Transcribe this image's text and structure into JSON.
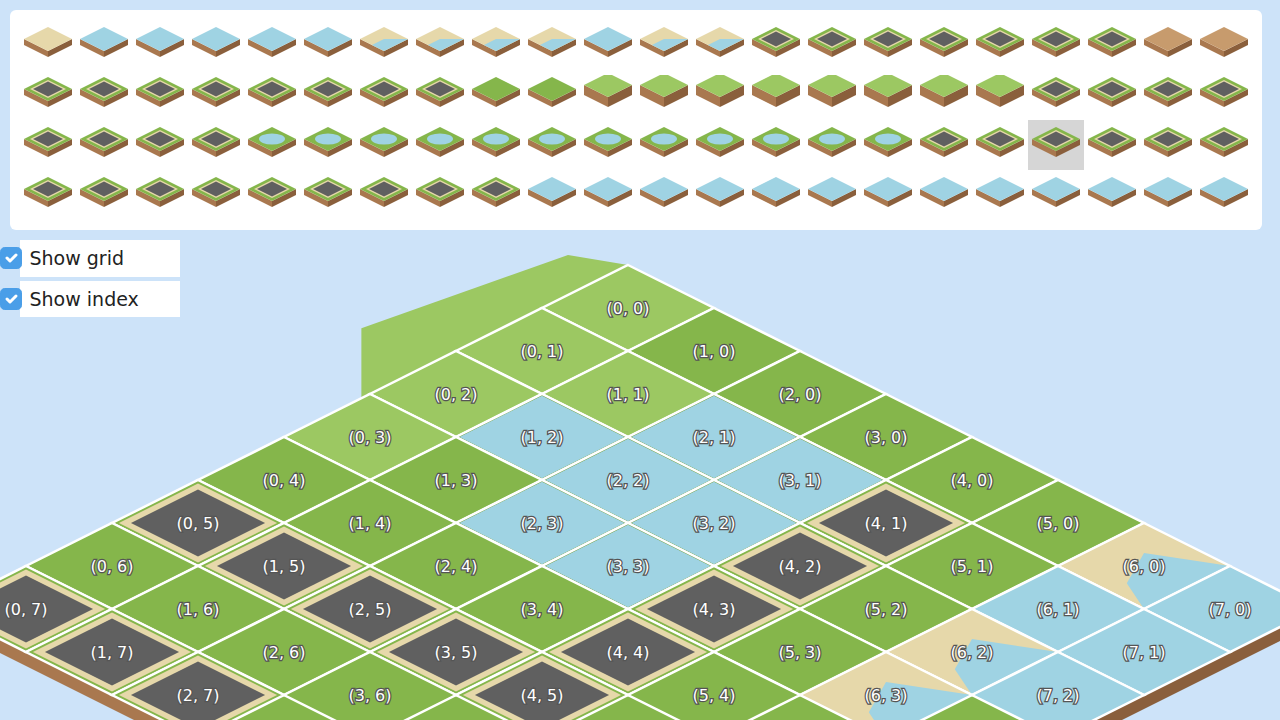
{
  "palette": {
    "tiles": [
      {
        "kind": "sand",
        "selected": false
      },
      {
        "kind": "water",
        "selected": false
      },
      {
        "kind": "water",
        "selected": false
      },
      {
        "kind": "water",
        "selected": false
      },
      {
        "kind": "water",
        "selected": false
      },
      {
        "kind": "water",
        "selected": false
      },
      {
        "kind": "shore",
        "selected": false
      },
      {
        "kind": "shore",
        "selected": false
      },
      {
        "kind": "shore",
        "selected": false
      },
      {
        "kind": "shore",
        "selected": false
      },
      {
        "kind": "water",
        "selected": false
      },
      {
        "kind": "shore",
        "selected": false
      },
      {
        "kind": "shore",
        "selected": false
      },
      {
        "kind": "road",
        "selected": false
      },
      {
        "kind": "road",
        "selected": false
      },
      {
        "kind": "road",
        "selected": false
      },
      {
        "kind": "road",
        "selected": false
      },
      {
        "kind": "road",
        "selected": false
      },
      {
        "kind": "road",
        "selected": false
      },
      {
        "kind": "road",
        "selected": false
      },
      {
        "kind": "dirt",
        "selected": false
      },
      {
        "kind": "dirt",
        "selected": false
      },
      {
        "kind": "road",
        "selected": false
      },
      {
        "kind": "road",
        "selected": false
      },
      {
        "kind": "road",
        "selected": false
      },
      {
        "kind": "road",
        "selected": false
      },
      {
        "kind": "road",
        "selected": false
      },
      {
        "kind": "road",
        "selected": false
      },
      {
        "kind": "road",
        "selected": false
      },
      {
        "kind": "road",
        "selected": false
      },
      {
        "kind": "grass",
        "selected": false
      },
      {
        "kind": "grass",
        "selected": false
      },
      {
        "kind": "hill",
        "selected": false
      },
      {
        "kind": "hill",
        "selected": false
      },
      {
        "kind": "hill",
        "selected": false
      },
      {
        "kind": "hill",
        "selected": false
      },
      {
        "kind": "hill",
        "selected": false
      },
      {
        "kind": "hill",
        "selected": false
      },
      {
        "kind": "hill",
        "selected": false
      },
      {
        "kind": "hill",
        "selected": false
      },
      {
        "kind": "road",
        "selected": false
      },
      {
        "kind": "road",
        "selected": false
      },
      {
        "kind": "road",
        "selected": false
      },
      {
        "kind": "road",
        "selected": false
      },
      {
        "kind": "road",
        "selected": false
      },
      {
        "kind": "road",
        "selected": false
      },
      {
        "kind": "road",
        "selected": false
      },
      {
        "kind": "road",
        "selected": false
      },
      {
        "kind": "pond",
        "selected": false
      },
      {
        "kind": "pond",
        "selected": false
      },
      {
        "kind": "pond",
        "selected": false
      },
      {
        "kind": "pond",
        "selected": false
      },
      {
        "kind": "pond",
        "selected": false
      },
      {
        "kind": "pond",
        "selected": false
      },
      {
        "kind": "pond",
        "selected": false
      },
      {
        "kind": "pond",
        "selected": false
      },
      {
        "kind": "pond",
        "selected": false
      },
      {
        "kind": "pond",
        "selected": false
      },
      {
        "kind": "pond",
        "selected": false
      },
      {
        "kind": "pond",
        "selected": false
      },
      {
        "kind": "road",
        "selected": false
      },
      {
        "kind": "road",
        "selected": false
      },
      {
        "kind": "road",
        "selected": true
      },
      {
        "kind": "road",
        "selected": false
      },
      {
        "kind": "road",
        "selected": false
      },
      {
        "kind": "road",
        "selected": false
      },
      {
        "kind": "road",
        "selected": false
      },
      {
        "kind": "road",
        "selected": false
      },
      {
        "kind": "road",
        "selected": false
      },
      {
        "kind": "road",
        "selected": false
      },
      {
        "kind": "road",
        "selected": false
      },
      {
        "kind": "road",
        "selected": false
      },
      {
        "kind": "road",
        "selected": false
      },
      {
        "kind": "road",
        "selected": false
      },
      {
        "kind": "road",
        "selected": false
      },
      {
        "kind": "water",
        "selected": false
      },
      {
        "kind": "water",
        "selected": false
      },
      {
        "kind": "water",
        "selected": false
      },
      {
        "kind": "water",
        "selected": false
      },
      {
        "kind": "water",
        "selected": false
      },
      {
        "kind": "water",
        "selected": false
      },
      {
        "kind": "water",
        "selected": false
      },
      {
        "kind": "water",
        "selected": false
      },
      {
        "kind": "water",
        "selected": false
      },
      {
        "kind": "water",
        "selected": false
      },
      {
        "kind": "water",
        "selected": false
      },
      {
        "kind": "water",
        "selected": false
      },
      {
        "kind": "water",
        "selected": false
      }
    ]
  },
  "options": [
    {
      "label": "Show grid",
      "checked": true
    },
    {
      "label": "Show index",
      "checked": true
    }
  ],
  "map": {
    "tiles": [
      {
        "label": "(0, 0)",
        "kind": "hill"
      },
      {
        "label": "(1, 0)",
        "kind": "grass"
      },
      {
        "label": "(2, 0)",
        "kind": "grass"
      },
      {
        "label": "(3, 0)",
        "kind": "grass"
      },
      {
        "label": "(4, 0)",
        "kind": "grass"
      },
      {
        "label": "(5, 0)",
        "kind": "grass"
      },
      {
        "label": "(6, 0)",
        "kind": "shore"
      },
      {
        "label": "(7, 0)",
        "kind": "sea"
      },
      {
        "label": "(0, 1)",
        "kind": "hill"
      },
      {
        "label": "(1, 1)",
        "kind": "hill"
      },
      {
        "label": "(2, 1)",
        "kind": "pond"
      },
      {
        "label": "(3, 1)",
        "kind": "pond"
      },
      {
        "label": "(4, 1)",
        "kind": "road"
      },
      {
        "label": "(5, 1)",
        "kind": "grass"
      },
      {
        "label": "(6, 1)",
        "kind": "sea"
      },
      {
        "label": "(7, 1)",
        "kind": "sea"
      },
      {
        "label": "(0, 2)",
        "kind": "hill"
      },
      {
        "label": "(1, 2)",
        "kind": "pond"
      },
      {
        "label": "(2, 2)",
        "kind": "pond"
      },
      {
        "label": "(3, 2)",
        "kind": "pond"
      },
      {
        "label": "(4, 2)",
        "kind": "road"
      },
      {
        "label": "(5, 2)",
        "kind": "grass"
      },
      {
        "label": "(6, 2)",
        "kind": "shore"
      },
      {
        "label": "(7, 2)",
        "kind": "sea"
      },
      {
        "label": "(0, 3)",
        "kind": "hill"
      },
      {
        "label": "(1, 3)",
        "kind": "grass"
      },
      {
        "label": "(2, 3)",
        "kind": "pond"
      },
      {
        "label": "(3, 3)",
        "kind": "pond"
      },
      {
        "label": "(4, 3)",
        "kind": "road"
      },
      {
        "label": "(5, 3)",
        "kind": "grass"
      },
      {
        "label": "(6, 3)",
        "kind": "shore"
      },
      {
        "label": "(0, 4)",
        "kind": "grass"
      },
      {
        "label": "(1, 4)",
        "kind": "grass"
      },
      {
        "label": "(2, 4)",
        "kind": "grass"
      },
      {
        "label": "(3, 4)",
        "kind": "grass"
      },
      {
        "label": "(4, 4)",
        "kind": "road"
      },
      {
        "label": "(5, 4)",
        "kind": "grass"
      },
      {
        "label": "(0, 5)",
        "kind": "road"
      },
      {
        "label": "(1, 5)",
        "kind": "road"
      },
      {
        "label": "(2, 5)",
        "kind": "road"
      },
      {
        "label": "(3, 5)",
        "kind": "road"
      },
      {
        "label": "(4, 5)",
        "kind": "road"
      },
      {
        "label": "(0, 6)",
        "kind": "grass"
      },
      {
        "label": "(1, 6)",
        "kind": "grass"
      },
      {
        "label": "(2, 6)",
        "kind": "grass"
      },
      {
        "label": "(3, 6)",
        "kind": "grass"
      },
      {
        "label": "(0, 7)",
        "kind": "road"
      },
      {
        "label": "(1, 7)",
        "kind": "road"
      },
      {
        "label": "(2, 7)",
        "kind": "road"
      }
    ]
  }
}
